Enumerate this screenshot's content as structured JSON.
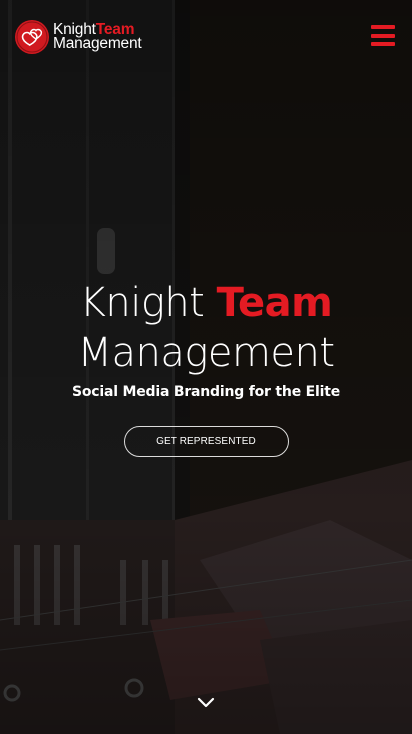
{
  "header": {
    "logo_word1": "Knight",
    "logo_word2": "Team",
    "logo_word3": "Management",
    "menu_icon": "hamburger-menu-icon"
  },
  "hero": {
    "title_word1": "Knight",
    "title_word2": "Team",
    "title_line2": "Management",
    "subtitle": "Social Media Branding for the Elite",
    "cta_label": "GET REPRESENTED",
    "scroll_icon": "chevron-down-icon"
  },
  "colors": {
    "accent": "#e41b23",
    "text": "#ffffff",
    "background": "#0d0d0d"
  }
}
